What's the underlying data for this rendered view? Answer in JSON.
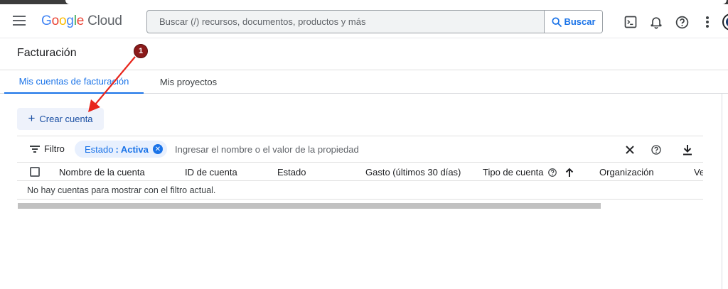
{
  "header": {
    "logo_letters": [
      "G",
      "o",
      "o",
      "g",
      "l",
      "e"
    ],
    "logo_suffix": "Cloud",
    "search_placeholder": "Buscar (/) recursos, documentos, productos y más",
    "search_button": "Buscar",
    "icons": [
      "terminal-icon",
      "bell-icon",
      "help-icon",
      "more-vert-icon",
      "avatar"
    ]
  },
  "page": {
    "title": "Facturación",
    "annotation_badge": "1"
  },
  "tabs": [
    {
      "label": "Mis cuentas de facturación",
      "active": true
    },
    {
      "label": "Mis proyectos",
      "active": false
    }
  ],
  "actions": {
    "create_account": "Crear cuenta"
  },
  "filter": {
    "label": "Filtro",
    "chip_key": "Estado",
    "chip_separator": ":",
    "chip_value": "Activa",
    "input_placeholder": "Ingresar el nombre o el valor de la propiedad"
  },
  "table": {
    "columns": [
      "Nombre de la cuenta",
      "ID de cuenta",
      "Estado",
      "Gasto (últimos 30 días)",
      "Tipo de cuenta",
      "Organización",
      "Ve"
    ],
    "empty_message": "No hay cuentas para mostrar con el filtro actual."
  },
  "colors": {
    "accent": "#1a73e8",
    "annotation_arrow": "#e8261c",
    "annotation_badge": "#8b1a1a"
  }
}
